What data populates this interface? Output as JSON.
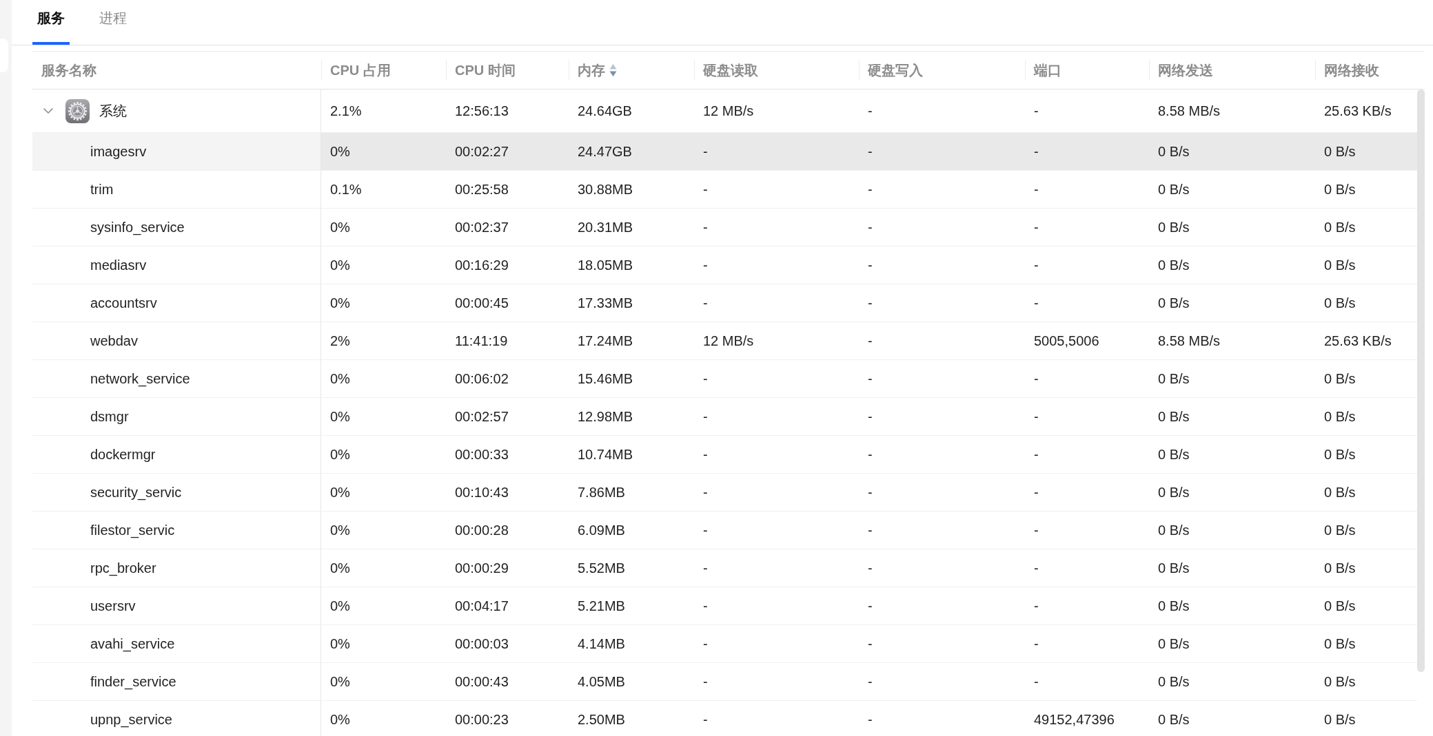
{
  "tabs": [
    {
      "label": "服务",
      "selected": true
    },
    {
      "label": "进程",
      "selected": false
    }
  ],
  "table": {
    "columns": [
      {
        "label": "服务名称"
      },
      {
        "label": "CPU 占用"
      },
      {
        "label": "CPU 时间"
      },
      {
        "label": "内存",
        "sorted": true,
        "descending": true
      },
      {
        "label": "硬盘读取"
      },
      {
        "label": "硬盘写入"
      },
      {
        "label": "端口"
      },
      {
        "label": "网络发送"
      },
      {
        "label": "网络接收"
      }
    ],
    "rows": [
      {
        "expanded": true,
        "selected": false,
        "cells": [
          "系统",
          "2.1%",
          "12:56:13",
          "24.64GB",
          "12 MB/s",
          "-",
          "-",
          "8.58 MB/s",
          "25.63 KB/s"
        ],
        "children": [
          {
            "selected": true,
            "cells": [
              "imagesrv",
              "0%",
              "00:02:27",
              "24.47GB",
              "-",
              "-",
              "-",
              "0 B/s",
              "0 B/s"
            ]
          },
          {
            "selected": false,
            "cells": [
              "trim",
              "0.1%",
              "00:25:58",
              "30.88MB",
              "-",
              "-",
              "-",
              "0 B/s",
              "0 B/s"
            ]
          },
          {
            "selected": false,
            "cells": [
              "sysinfo_service",
              "0%",
              "00:02:37",
              "20.31MB",
              "-",
              "-",
              "-",
              "0 B/s",
              "0 B/s"
            ]
          },
          {
            "selected": false,
            "cells": [
              "mediasrv",
              "0%",
              "00:16:29",
              "18.05MB",
              "-",
              "-",
              "-",
              "0 B/s",
              "0 B/s"
            ]
          },
          {
            "selected": false,
            "cells": [
              "accountsrv",
              "0%",
              "00:00:45",
              "17.33MB",
              "-",
              "-",
              "-",
              "0 B/s",
              "0 B/s"
            ]
          },
          {
            "selected": false,
            "cells": [
              "webdav",
              "2%",
              "11:41:19",
              "17.24MB",
              "12 MB/s",
              "-",
              "5005,5006",
              "8.58 MB/s",
              "25.63 KB/s"
            ]
          },
          {
            "selected": false,
            "cells": [
              "network_service",
              "0%",
              "00:06:02",
              "15.46MB",
              "-",
              "-",
              "-",
              "0 B/s",
              "0 B/s"
            ]
          },
          {
            "selected": false,
            "cells": [
              "dsmgr",
              "0%",
              "00:02:57",
              "12.98MB",
              "-",
              "-",
              "-",
              "0 B/s",
              "0 B/s"
            ]
          },
          {
            "selected": false,
            "cells": [
              "dockermgr",
              "0%",
              "00:00:33",
              "10.74MB",
              "-",
              "-",
              "-",
              "0 B/s",
              "0 B/s"
            ]
          },
          {
            "selected": false,
            "cells": [
              "security_servic",
              "0%",
              "00:10:43",
              "7.86MB",
              "-",
              "-",
              "-",
              "0 B/s",
              "0 B/s"
            ]
          },
          {
            "selected": false,
            "cells": [
              "filestor_servic",
              "0%",
              "00:00:28",
              "6.09MB",
              "-",
              "-",
              "-",
              "0 B/s",
              "0 B/s"
            ]
          },
          {
            "selected": false,
            "cells": [
              "rpc_broker",
              "0%",
              "00:00:29",
              "5.52MB",
              "-",
              "-",
              "-",
              "0 B/s",
              "0 B/s"
            ]
          },
          {
            "selected": false,
            "cells": [
              "usersrv",
              "0%",
              "00:04:17",
              "5.21MB",
              "-",
              "-",
              "-",
              "0 B/s",
              "0 B/s"
            ]
          },
          {
            "selected": false,
            "cells": [
              "avahi_service",
              "0%",
              "00:00:03",
              "4.14MB",
              "-",
              "-",
              "-",
              "0 B/s",
              "0 B/s"
            ]
          },
          {
            "selected": false,
            "cells": [
              "finder_service",
              "0%",
              "00:00:43",
              "4.05MB",
              "-",
              "-",
              "-",
              "0 B/s",
              "0 B/s"
            ]
          },
          {
            "selected": false,
            "cells": [
              "upnp_service",
              "0%",
              "00:00:23",
              "2.50MB",
              "-",
              "-",
              "49152,47396",
              "0 B/s",
              "0 B/s"
            ]
          }
        ]
      }
    ]
  }
}
